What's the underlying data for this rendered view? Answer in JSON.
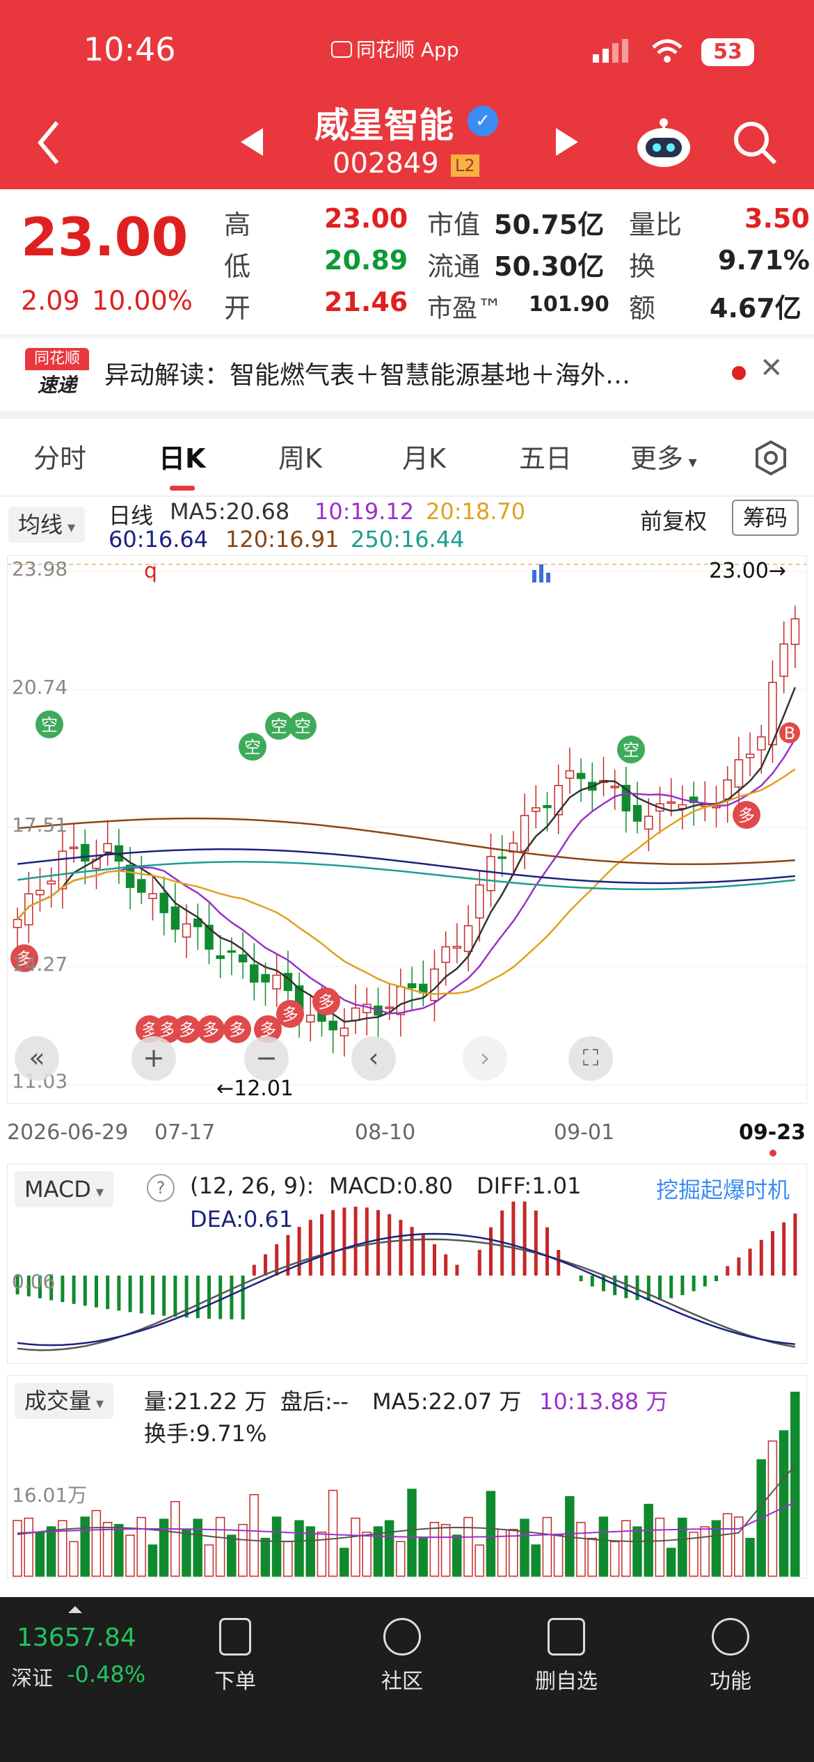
{
  "status_bar": {
    "time": "10:46",
    "app_label": "同花顺 App",
    "battery": "53"
  },
  "stock": {
    "name": "威星智能",
    "code": "002849",
    "level_badge": "L2"
  },
  "quote": {
    "price": "23.00",
    "change": "2.09",
    "change_pct": "10.00%",
    "high_label": "高",
    "high": "23.00",
    "low_label": "低",
    "low": "20.89",
    "open_label": "开",
    "open": "21.46",
    "mktcap_label": "市值",
    "mktcap": "50.75亿",
    "float_label": "流通",
    "float": "50.30亿",
    "pe_label": "市盈™",
    "pe": "101.90",
    "vol_ratio_label": "量比",
    "vol_ratio": "3.50",
    "turnover_label": "换",
    "turnover": "9.71%",
    "amount_label": "额",
    "amount": "4.67亿"
  },
  "news": {
    "badge_top": "同花顺",
    "badge_bottom": "速递",
    "text": "异动解读：智能燃气表＋智慧能源基地＋海外…"
  },
  "tabs": [
    "分时",
    "日K",
    "周K",
    "月K",
    "五日",
    "更多"
  ],
  "active_tab": "日K",
  "kline": {
    "ma_dropdown": "均线",
    "period_label": "日线",
    "ma5": "MA5:20.68",
    "ma10": "10:19.12",
    "ma20": "20:18.70",
    "ma60": "60:16.64",
    "ma120": "120:16.91",
    "ma250": "250:16.44",
    "adjust_label": "前复权",
    "chip_button": "筹码",
    "y_ticks": [
      "23.98",
      "20.74",
      "17.51",
      "14.27",
      "11.03"
    ],
    "x_ticks": [
      "2026-06-29",
      "07-17",
      "08-10",
      "09-01",
      "09-23"
    ],
    "high_marker": "23.00→",
    "low_marker": "←12.01",
    "markers": {
      "q": "q",
      "empty": "空",
      "many": "多",
      "buy": "B"
    },
    "colors": {
      "ma5": "#333333",
      "ma10": "#9b30c8",
      "ma20": "#e0a020",
      "ma60": "#1a237e",
      "ma120": "#8b4513",
      "ma250": "#1a9e8f",
      "up": "#c62828",
      "down": "#108a2e"
    }
  },
  "macd": {
    "dropdown": "MACD",
    "params": "(12, 26, 9):",
    "macd": "MACD:0.80",
    "diff": "DIFF:1.01",
    "dea": "DEA:0.61",
    "promo": "挖掘起爆时机",
    "y_tick": "0.06"
  },
  "volume": {
    "dropdown": "成交量",
    "vol": "量:21.22 万",
    "after_hours": "盘后:--",
    "ma5": "MA5:22.07 万",
    "ma10": "10:13.88 万",
    "turnover": "换手:9.71%",
    "y_tick": "16.01万"
  },
  "bottom_nav": {
    "index_value": "13657.84",
    "index_name": "深证",
    "index_change": "-0.48%",
    "items": [
      "下单",
      "社区",
      "删自选",
      "功能"
    ]
  }
}
